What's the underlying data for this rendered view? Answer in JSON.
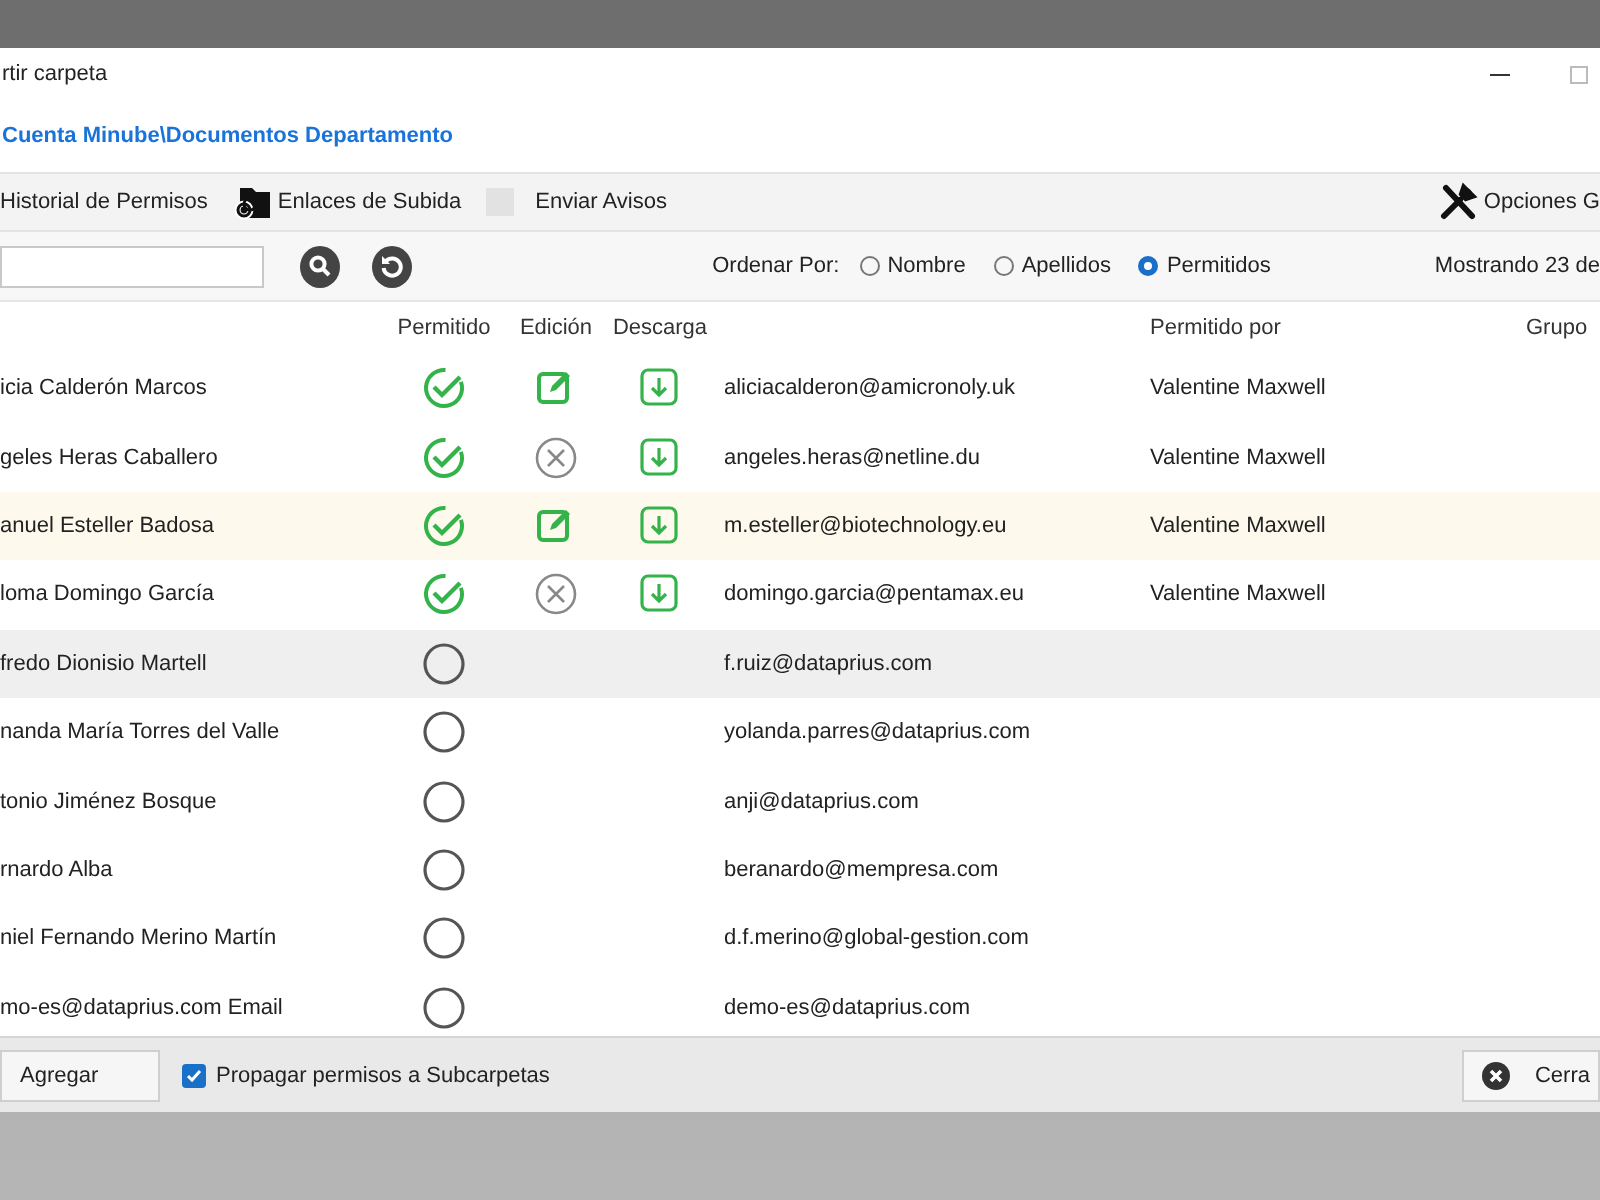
{
  "window": {
    "title": "rtir carpeta",
    "path": "Cuenta Minube\\Documentos Departamento"
  },
  "toolbar": {
    "history": "Historial de Permisos",
    "upload_links": "Enlaces de Subida",
    "send_notices": {
      "label": "Enviar Avisos",
      "checked": false
    },
    "options": "Opciones G"
  },
  "sort": {
    "label": "Ordenar Por:",
    "options": [
      {
        "label": "Nombre",
        "selected": false
      },
      {
        "label": "Apellidos",
        "selected": false
      },
      {
        "label": "Permitidos",
        "selected": true
      }
    ]
  },
  "count": "Mostrando 23 de",
  "table": {
    "header": {
      "allowed": "Permitido",
      "edit": "Edición",
      "download": "Descarga",
      "allowed_by": "Permitido por",
      "group": "Grupo"
    },
    "rows": [
      {
        "name": "icia Calderón Marcos",
        "allowed": true,
        "edit": true,
        "download": true,
        "email": "aliciacalderon@amicronoly.uk",
        "allowed_by": "Valentine Maxwell",
        "selected": false,
        "hovered": false
      },
      {
        "name": "geles Heras Caballero",
        "allowed": true,
        "edit": false,
        "download": true,
        "email": "angeles.heras@netline.du",
        "allowed_by": "Valentine Maxwell",
        "selected": false,
        "hovered": false
      },
      {
        "name": "anuel Esteller Badosa",
        "allowed": true,
        "edit": true,
        "download": true,
        "email": "m.esteller@biotechnology.eu",
        "allowed_by": "Valentine Maxwell",
        "selected": true,
        "hovered": false
      },
      {
        "name": "loma Domingo García",
        "allowed": true,
        "edit": false,
        "download": true,
        "email": "domingo.garcia@pentamax.eu",
        "allowed_by": "Valentine Maxwell",
        "selected": false,
        "hovered": false
      },
      {
        "name": "fredo Dionisio Martell",
        "allowed": false,
        "email": "f.ruiz@dataprius.com",
        "selected": false,
        "hovered": true
      },
      {
        "name": "nanda María Torres del Valle",
        "allowed": false,
        "email": "yolanda.parres@dataprius.com",
        "selected": false,
        "hovered": false
      },
      {
        "name": "tonio Jiménez Bosque",
        "allowed": false,
        "email": "anji@dataprius.com",
        "selected": false,
        "hovered": false
      },
      {
        "name": "rnardo Alba",
        "allowed": false,
        "email": "beranardo@mempresa.com",
        "selected": false,
        "hovered": false
      },
      {
        "name": "niel Fernando Merino Martín",
        "allowed": false,
        "email": "d.f.merino@global-gestion.com",
        "selected": false,
        "hovered": false
      },
      {
        "name": "mo-es@dataprius.com Email",
        "allowed": false,
        "email": "demo-es@dataprius.com",
        "selected": false,
        "hovered": false
      }
    ]
  },
  "footer": {
    "add": "Agregar",
    "propagate": {
      "label": "Propagar permisos a Subcarpetas",
      "checked": true
    },
    "close": "Cerra"
  }
}
